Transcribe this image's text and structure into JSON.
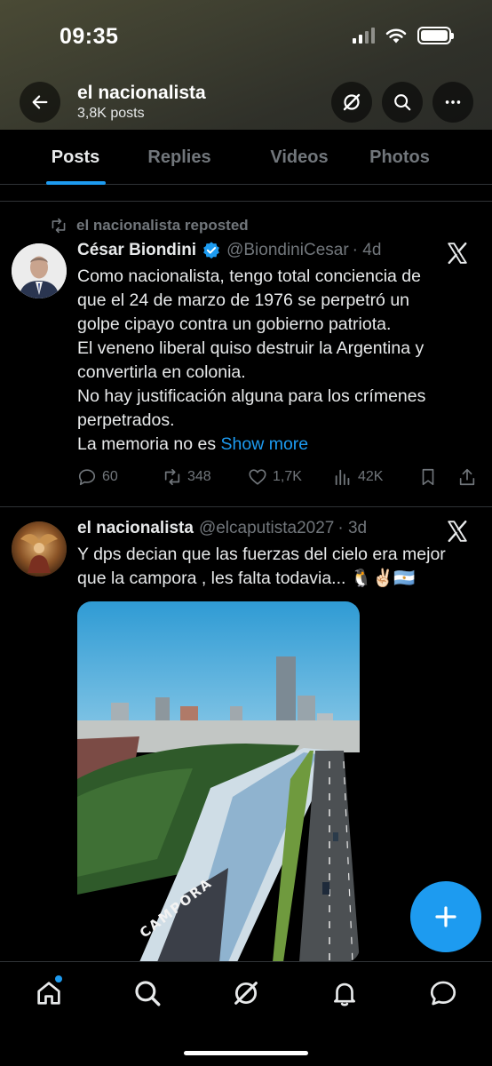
{
  "status_bar": {
    "time": "09:35"
  },
  "header": {
    "title": "el nacionalista",
    "subtitle": "3,8K posts"
  },
  "tabs": [
    {
      "label": "Posts",
      "active": true
    },
    {
      "label": "Replies",
      "active": false
    },
    {
      "label": "Videos",
      "active": false
    },
    {
      "label": "Photos",
      "active": false
    }
  ],
  "posts": [
    {
      "repost_label": "el nacionalista reposted",
      "author": "César Biondini",
      "verified": true,
      "handle": "@BiondiniCesar",
      "time": "· 4d",
      "lines": [
        "Como nacionalista, tengo total conciencia de",
        "que el 24 de marzo de 1976 se perpetró un",
        "golpe cipayo contra un gobierno patriota.",
        "El veneno liberal quiso destruir la Argentina y",
        "convertirla en colonia.",
        "No hay justificación alguna para los crímenes",
        "perpetrados.",
        "La memoria no es"
      ],
      "show_more": "Show more",
      "stats": {
        "replies": "60",
        "reposts": "348",
        "likes": "1,7K",
        "views": "42K"
      }
    },
    {
      "author": "el nacionalista",
      "handle": "@elcaputista2027",
      "time": "· 3d",
      "lines": [
        "Y dps decian que las fuerzas del cielo era mejor",
        "que la campora , les falta todavia... 🐧✌🏻🇦🇷"
      ],
      "media_banner_text": "CAMPORA"
    }
  ],
  "colors": {
    "accent": "#1d9bf0",
    "muted": "#71767b",
    "text": "#e7e9ea",
    "background": "#000000"
  }
}
